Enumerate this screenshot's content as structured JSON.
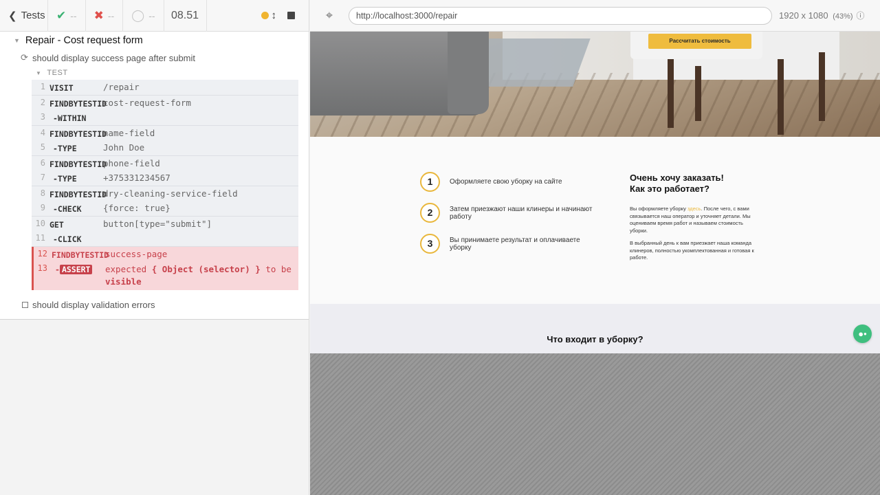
{
  "reporter": {
    "tests_label": "Tests",
    "passed": "--",
    "failed": "--",
    "pending": "--",
    "duration": "08.51",
    "suite_title": "Repair - Cost request form",
    "test1_title": "should display success page after submit",
    "section_label": "TEST",
    "commands": [
      {
        "num": "1",
        "name": "VISIT",
        "msg": "/repair"
      },
      {
        "num": "2",
        "name": "FINDBYTESTID",
        "msg": "cost-request-form"
      },
      {
        "num": "3",
        "name": "-WITHIN",
        "msg": ""
      },
      {
        "num": "4",
        "name": "FINDBYTESTID",
        "msg": "name-field"
      },
      {
        "num": "5",
        "name": "-TYPE",
        "msg": "John Doe"
      },
      {
        "num": "6",
        "name": "FINDBYTESTID",
        "msg": "phone-field"
      },
      {
        "num": "7",
        "name": "-TYPE",
        "msg": "+375331234567"
      },
      {
        "num": "8",
        "name": "FINDBYTESTID",
        "msg": "dry-cleaning-service-field"
      },
      {
        "num": "9",
        "name": "-CHECK",
        "msg": "{force: true}"
      },
      {
        "num": "10",
        "name": "GET",
        "msg": "button[type=\"submit\"]"
      },
      {
        "num": "11",
        "name": "-CLICK",
        "msg": ""
      },
      {
        "num": "12",
        "name": "FINDBYTESTID",
        "msg": "success-page"
      },
      {
        "num": "13",
        "name": "ASSERT",
        "msg_expected": "expected",
        "msg_obj": "{ Object (selector) }",
        "msg_tobe": "to be",
        "msg_visible": "visible"
      }
    ],
    "test2_title": "should display validation errors"
  },
  "aut": {
    "url": "http://localhost:3000/repair",
    "viewport": "1920 x 1080",
    "scale": "(43%)",
    "cost_button": "Рассчитать стоимость",
    "steps": [
      {
        "n": "1",
        "text": "Оформляете свою уборку на сайте"
      },
      {
        "n": "2",
        "text": "Затем приезжают наши клинеры и начинают работу"
      },
      {
        "n": "3",
        "text": "Вы принимаете результат и оплачиваете уборку"
      }
    ],
    "how_title_line1": "Очень хочу заказать!",
    "how_title_line2": "Как это работает?",
    "desc_p1_a": "Вы оформляете уборку ",
    "desc_p1_link": "здесь",
    "desc_p1_b": ". После чего, с вами связывается наш оператор и уточняет детали. Мы оцениваем время работ и называем стоимость уборки.",
    "desc_p2": "В выбранный день к вам приезжает наша команда клинеров, полностью укомплектованная и готовая к работе.",
    "includes_title": "Что входит в уборку?"
  },
  "colors": {
    "accent": "#efbc3e",
    "fail": "#c7414b",
    "pass": "#3bb273",
    "chat": "#3fbf7f"
  }
}
